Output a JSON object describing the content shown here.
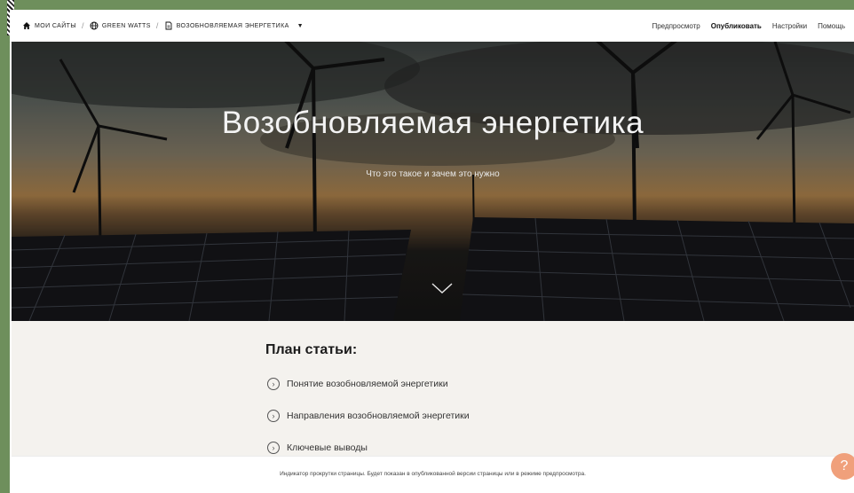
{
  "breadcrumbs": {
    "my_sites": "МОИ САЙТЫ",
    "site": "GREEN WATTS",
    "page": "ВОЗОБНОВЛЯЕМАЯ ЭНЕРГЕТИКА"
  },
  "actions": {
    "preview": "Предпросмотр",
    "publish": "Опубликовать",
    "settings": "Настройки",
    "help": "Помощь"
  },
  "hero": {
    "title": "Возобновляемая энергетика",
    "subtitle": "Что это такое и зачем это нужно"
  },
  "plan": {
    "title": "План статьи:",
    "items": [
      "Понятие возобновляемой энергетики",
      "Направления возобновляемой энергетики",
      "Ключевые выводы"
    ]
  },
  "note": "Индикатор прокрутки страницы. Будет показан в опубликованной версии страницы или в режиме предпросмотра.",
  "help_glyph": "?",
  "icons": {
    "home": "home-icon",
    "globe": "globe-icon",
    "page": "page-icon",
    "caret": "caret-down-icon",
    "chevron": "chevron-down-icon",
    "item": "chevron-right-icon",
    "help": "help-icon"
  },
  "colors": {
    "background": "#6e8f5c",
    "plan_bg": "#f4f2ee",
    "help_button": "#f0a07b"
  }
}
